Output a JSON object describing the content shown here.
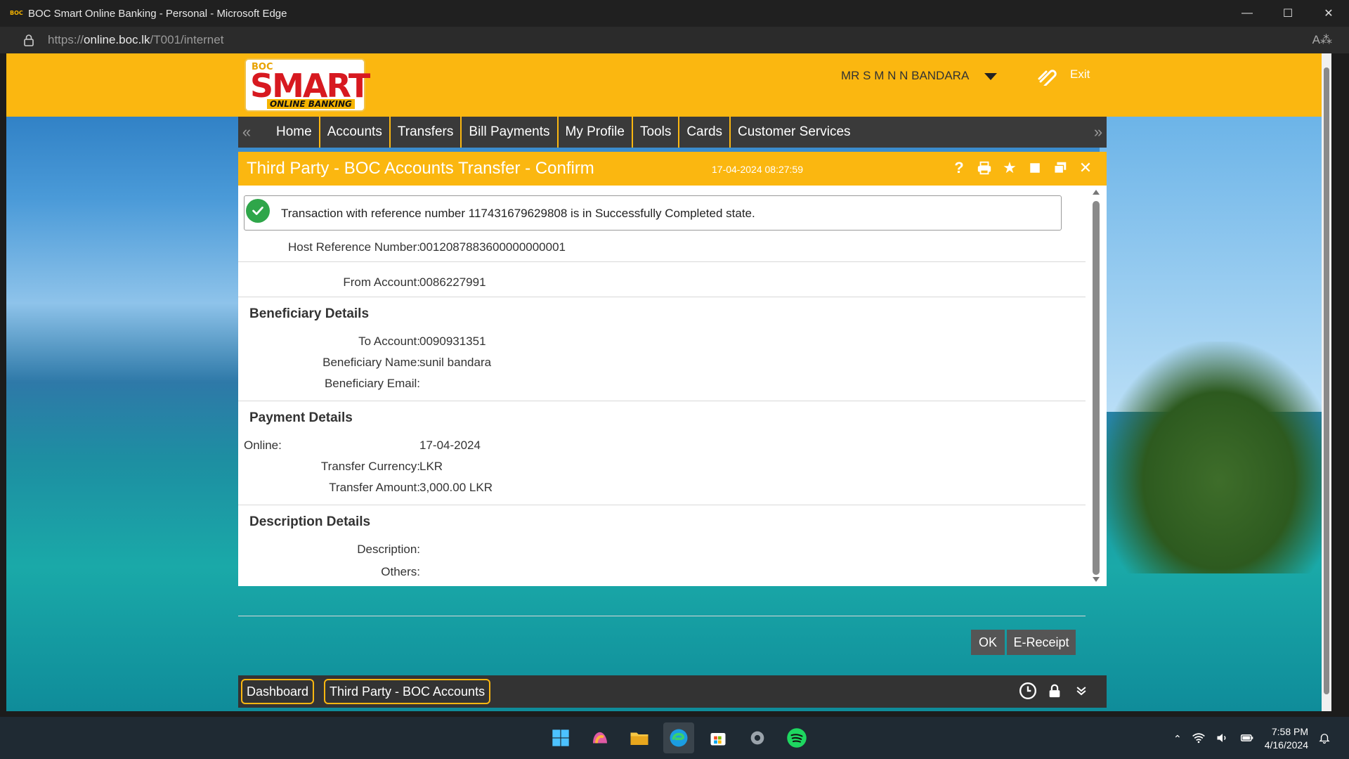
{
  "browser": {
    "title": "BOC Smart Online Banking - Personal - Microsoft Edge",
    "favicon_text": "BOC",
    "url_prefix": "https://",
    "url_host": "online.boc.lk",
    "url_path": "/T001/internet"
  },
  "header": {
    "logo_boc": "BOC",
    "logo_smart": "SMART",
    "logo_sub": "ONLINE BANKING",
    "user_name": "MR S M N N BANDARA",
    "exit_label": "Exit"
  },
  "nav": {
    "items": [
      "Home",
      "Accounts",
      "Transfers",
      "Bill Payments",
      "My Profile",
      "Tools",
      "Cards",
      "Customer Services"
    ]
  },
  "panel": {
    "title": "Third Party - BOC Accounts Transfer - Confirm",
    "timestamp": "17-04-2024 08:27:59",
    "success_message": "Transaction with reference number 117431679629808 is in Successfully Completed state.",
    "host_ref_label": "Host Reference Number:",
    "host_ref_value": "0012087883600000000001",
    "from_account_label": "From Account:",
    "from_account_value": "0086227991",
    "beneficiary_section": "Beneficiary Details",
    "to_account_label": "To Account:",
    "to_account_value": "0090931351",
    "beneficiary_name_label": "Beneficiary Name:",
    "beneficiary_name_value": "sunil bandara",
    "beneficiary_email_label": "Beneficiary Email:",
    "beneficiary_email_value": "",
    "payment_section": "Payment Details",
    "online_label": "Online:",
    "online_value": "17-04-2024",
    "currency_label": "Transfer Currency:",
    "currency_value": "LKR",
    "amount_label": "Transfer Amount:",
    "amount_value": "3,000.00 LKR",
    "description_section": "Description Details",
    "description_label": "Description:",
    "description_value": "",
    "others_label": "Others:",
    "others_value": "",
    "ok_button": "OK",
    "ereceipt_button": "E-Receipt"
  },
  "appbar": {
    "tabs": [
      "Dashboard",
      "Third Party - BOC Accounts"
    ]
  },
  "taskbar": {
    "time": "7:58 PM",
    "date": "4/16/2024"
  },
  "colors": {
    "brand_yellow": "#fbb710",
    "nav_dark": "#3a3a3a",
    "success_green": "#2fa64a",
    "button_gray": "#555555"
  }
}
